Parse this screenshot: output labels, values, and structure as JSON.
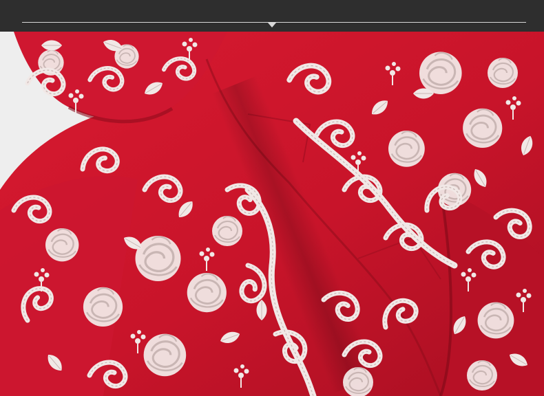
{
  "header": {
    "indicator_icon": "triangle-down-icon"
  },
  "photo": {
    "subject_icon": "embroidered-fabric-photo",
    "fabric_color": "#c8142a",
    "fabric_shadow_color": "#8f0c1c",
    "embroidery_color": "#f1e8e6",
    "backdrop_color": "#eeeeee"
  }
}
